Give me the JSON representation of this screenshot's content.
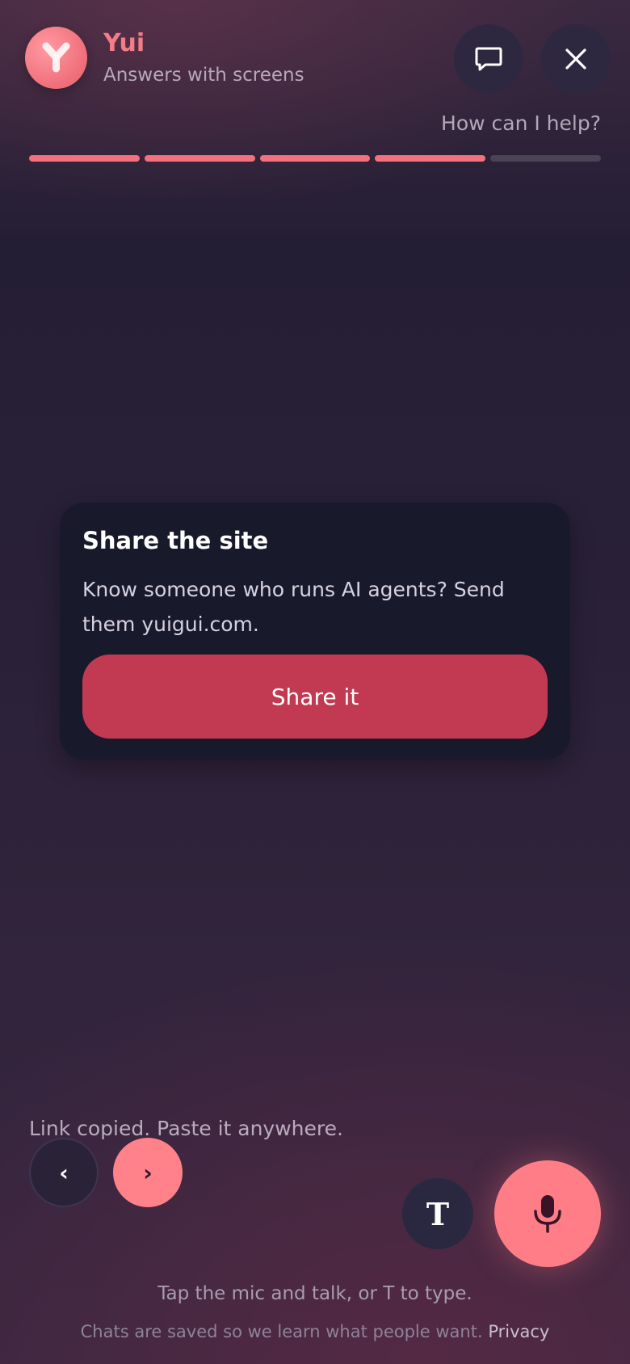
{
  "header": {
    "app_name": "Yui",
    "subtitle": "Answers with screens",
    "logo_icon": "yui-logo-icon",
    "chat_icon": "chat-bubble-icon",
    "close_icon": "close-icon",
    "help_text": "How can I help?"
  },
  "progress": {
    "total_steps": 5,
    "completed_steps": 4
  },
  "card": {
    "title": "Share the site",
    "body": "Know someone who runs AI agents? Send them yuigui.com.",
    "button_label": "Share it"
  },
  "bottom": {
    "status_text": "Link copied. Paste it anywhere.",
    "prev_label": "‹",
    "next_label": "›",
    "type_label": "T",
    "mic_icon": "microphone-icon",
    "hint_text": "Tap the mic and talk, or T to type.",
    "footer_text": "Chats are saved so we learn what people want.",
    "privacy_label": "Privacy"
  },
  "colors": {
    "accent": "#f47c86",
    "share_button": "#c23a52",
    "mic_button": "#ff7d86",
    "card_background": "#181a2c"
  }
}
